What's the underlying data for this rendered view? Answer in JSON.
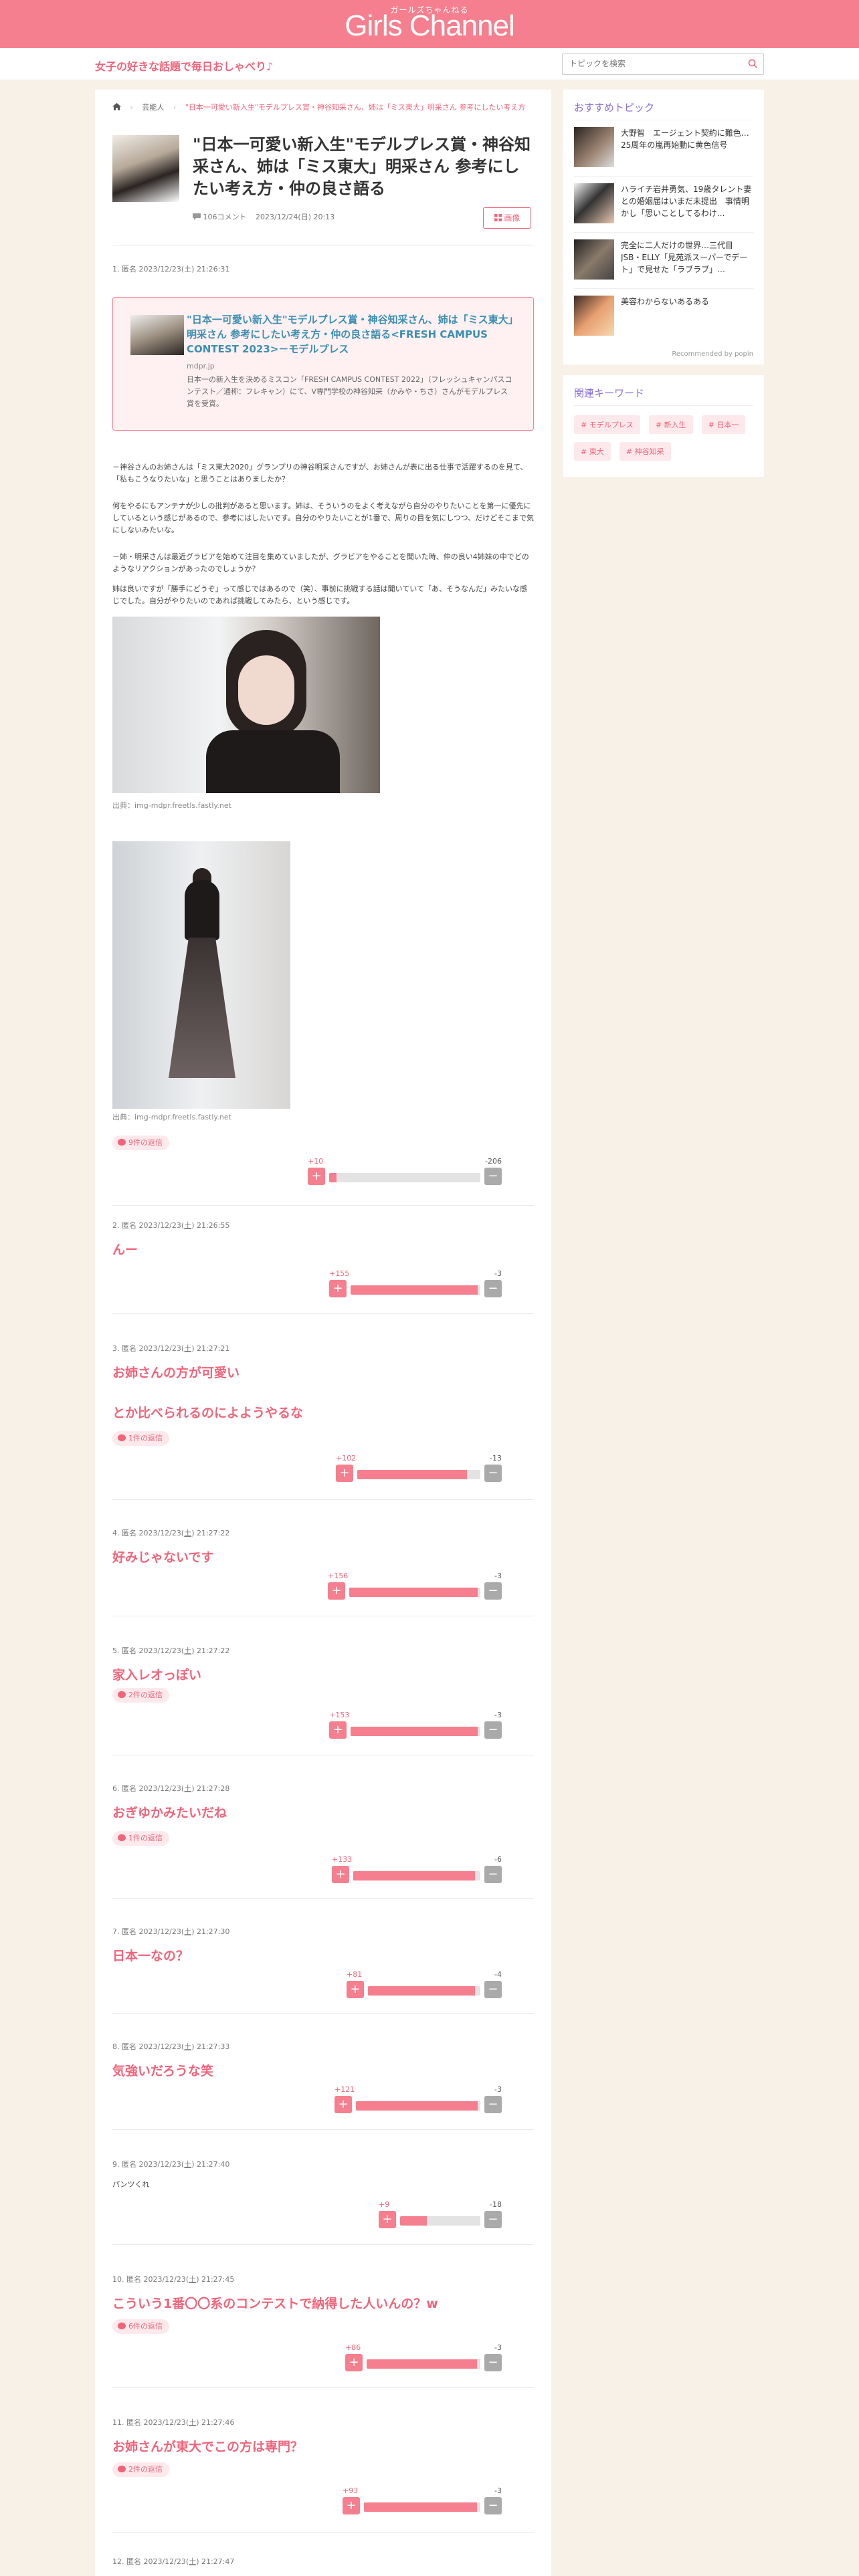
{
  "header": {
    "logo": "Girls Channel",
    "logo_sub": "ガールズちゃんねる"
  },
  "subbar": {
    "tagline": "女子の好きな話題で毎日おしゃべり♪",
    "search_placeholder": "トピックを検索"
  },
  "breadcrumb": {
    "category": "芸能人",
    "current": "\"日本一可愛い新入生\"モデルプレス賞・神谷知采さん、姉は「ミス東大」明采さん 参考にしたい考え方・仲の良"
  },
  "topic": {
    "title": "\"日本一可愛い新入生\"モデルプレス賞・神谷知采さん、姉は「ミス東大」明采さん 参考にしたい考え方・仲の良さ語る",
    "comments": "106コメント",
    "date": "2023/12/24(日) 20:13",
    "list_label": "画像"
  },
  "first_comment": {
    "meta": "1. 匿名 2023/12/23(土) 21:26:31",
    "quote_title": "\"日本一可愛い新入生\"モデルプレス賞・神谷知采さん、姉は「ミス東大」明采さん 参考にしたい考え方・仲の良さ語る<FRESH CAMPUS CONTEST 2023>－モデルプレス",
    "quote_source": "mdpr.jp",
    "quote_desc": "日本一の新入生を決めるミスコン「FRESH CAMPUS CONTEST 2022」（フレッシュキャンパスコンテスト／通称：フレキャン）にて、V専門学校の神谷知采（かみや・ちさ）さんがモデルプレス賞を受賞。",
    "paragraphs": [
      "－神谷さんのお姉さんは「ミス東大2020」グランプリの神谷明采さんですが、お姉さんが表に出る仕事で活躍するのを見て、「私もこうなりたいな」と思うことはありましたか？",
      "何をやるにもアンテナが少しの批判があると思います。姉は、そういうのをよく考えながら自分のやりたいことを第一に優先にしているという感じがあるので、参考にはしたいです。自分のやりたいことが1番で、周りの目を気にしつつ、だけどそこまで気にしないみたいな。",
      "－姉・明采さんは最近グラビアを始めて注目を集めていましたが、グラビアをやることを聞いた時、仲の良い4姉妹の中でどのようなリアクションがあったのでしょうか？",
      "姉は良いですが「勝手にどうぞ」って感じではあるので（笑）、事前に挑戦する話は聞いていて「あ、そうなんだ」みたいな感じでした。自分がやりたいのであれば挑戦してみたら、という感じです。"
    ],
    "img_source_1": "出典：img-mdpr.freetls.fastly.net",
    "img_source_2": "出典：img-mdpr.freetls.fastly.net",
    "replies": "9件の返信",
    "plus": "+10",
    "minus": "-206"
  },
  "comments": [
    {
      "meta_pre": "2. 匿名 2023/12/23(",
      "meta_day": "土",
      "meta_post": ") 21:26:55",
      "text": "んー",
      "replies": "",
      "plus": "+155",
      "minus": "-3"
    },
    {
      "meta_pre": "3. 匿名 2023/12/23(",
      "meta_day": "土",
      "meta_post": ") 21:27:21",
      "text": "お姉さんの方が可愛い",
      "text2": "とか比べられるのによようやるな",
      "replies": "1件の返信",
      "plus": "+102",
      "minus": "-13"
    },
    {
      "meta_pre": "4. 匿名 2023/12/23(",
      "meta_day": "土",
      "meta_post": ") 21:27:22",
      "text": "好みじゃないです",
      "replies": "",
      "plus": "+156",
      "minus": "-3"
    },
    {
      "meta_pre": "5. 匿名 2023/12/23(",
      "meta_day": "土",
      "meta_post": ") 21:27:22",
      "text": "家入レオっぽい",
      "replies": "2件の返信",
      "plus": "+153",
      "minus": "-3"
    },
    {
      "meta_pre": "6. 匿名 2023/12/23(",
      "meta_day": "土",
      "meta_post": ") 21:27:28",
      "text": "おぎゆかみたいだね",
      "replies": "1件の返信",
      "plus": "+133",
      "minus": "-6"
    },
    {
      "meta_pre": "7. 匿名 2023/12/23(",
      "meta_day": "土",
      "meta_post": ") 21:27:30",
      "text": "日本一なの？",
      "replies": "",
      "plus": "+81",
      "minus": "-4"
    },
    {
      "meta_pre": "8. 匿名 2023/12/23(",
      "meta_day": "土",
      "meta_post": ") 21:27:33",
      "text": "気強いだろうな笑",
      "replies": "",
      "plus": "+121",
      "minus": "-3"
    },
    {
      "meta_pre": "9. 匿名 2023/12/23(",
      "meta_day": "土",
      "meta_post": ") 21:27:40",
      "text": "パンツくれ",
      "small": true,
      "replies": "",
      "plus": "+9",
      "minus": "-18"
    },
    {
      "meta_pre": "10. 匿名 2023/12/23(",
      "meta_day": "土",
      "meta_post": ") 21:27:45",
      "text": "こういう1番〇〇系のコンテストで納得した人いんの？w",
      "replies": "6件の返信",
      "plus": "+86",
      "minus": "-3"
    },
    {
      "meta_pre": "11. 匿名 2023/12/23(",
      "meta_day": "土",
      "meta_post": ") 21:27:46",
      "text": "お姉さんが東大でこの方は専門？",
      "replies": "2件の返信",
      "plus": "+93",
      "minus": "-3"
    },
    {
      "meta_pre": "12. 匿名 2023/12/23(",
      "meta_day": "土",
      "meta_post": ") 21:27:47"
    }
  ],
  "sidebar": {
    "recommended_heading": "おすすめトピック",
    "recommended": [
      "大野智　エージェント契約に難色…25周年の嵐再始動に黄色信号",
      "ハライチ岩井勇気、19歳タレント妻との婚姻届はいまだ未提出　事情明かし「思いことしてるわけ…",
      "完全に二人だけの世界…三代目JSB・ELLY「見苑派スーパーでデート」で見せた「ラブラブ」…",
      "美容わからないあるある"
    ],
    "popin": "Recommended by popin",
    "keywords_heading": "関連キーワード",
    "keywords": [
      "# モデルプレス",
      "# 新入生",
      "# 日本一",
      "# 東大",
      "# 神谷知采"
    ]
  },
  "colors": {
    "brand": "#f57f8e",
    "accent_text": "#f0647a",
    "link_blue": "#3a8fb0",
    "background": "#f8f1e8"
  }
}
